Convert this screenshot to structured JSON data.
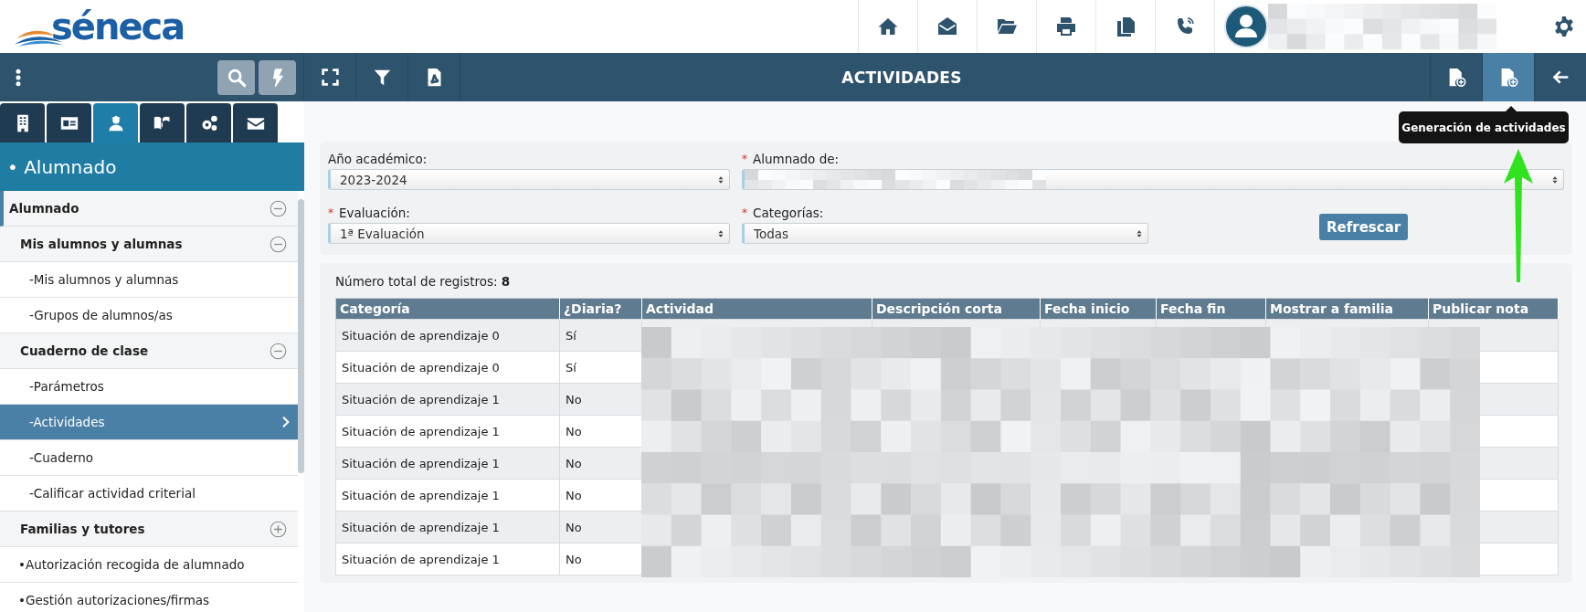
{
  "logo": {
    "text": "séneca"
  },
  "title": "ACTIVIDADES",
  "toolbar_right": [
    {
      "selected": false
    },
    {
      "selected": true
    },
    {
      "selected": false
    }
  ],
  "tooltip": "Generación de actividades",
  "sidebar": {
    "tabs": [
      {
        "selected": false
      },
      {
        "selected": false
      },
      {
        "selected": true
      },
      {
        "selected": false
      },
      {
        "selected": false
      },
      {
        "selected": false
      }
    ],
    "heading": "• Alumnado",
    "items": [
      {
        "label": "Alumnado",
        "kind": "section",
        "expanded": true,
        "children": [
          {
            "label": "Mis alumnos y alumnas",
            "kind": "group",
            "expanded": true,
            "children": [
              {
                "label": "-Mis alumnos y alumnas",
                "kind": "leaf",
                "selected": false
              },
              {
                "label": "-Grupos de alumnos/as",
                "kind": "leaf",
                "selected": false
              }
            ]
          },
          {
            "label": "Cuaderno de clase",
            "kind": "group",
            "expanded": true,
            "children": [
              {
                "label": "-Parámetros",
                "kind": "leaf",
                "selected": false
              },
              {
                "label": "-Actividades",
                "kind": "leaf",
                "selected": true
              },
              {
                "label": "-Cuaderno",
                "kind": "leaf",
                "selected": false
              },
              {
                "label": "-Calificar actividad criterial",
                "kind": "leaf",
                "selected": false
              }
            ]
          },
          {
            "label": "Familias y tutores",
            "kind": "group",
            "expanded": false
          },
          {
            "label": "•Autorización recogida de alumnado",
            "kind": "link",
            "selected": false
          },
          {
            "label": "•Gestión autorizaciones/firmas",
            "kind": "link",
            "selected": false
          }
        ]
      }
    ]
  },
  "form": {
    "rows": [
      [
        {
          "label": "Año académico:",
          "value": "2023-2024"
        },
        {
          "required_mark": "*",
          "label": "Alumnado de:"
        }
      ],
      [
        {
          "required_mark": "*",
          "label": "Evaluación:",
          "value": "1ª Evaluación"
        },
        {
          "required_mark": "*",
          "label": "Categorías:",
          "value": "Todas"
        }
      ]
    ],
    "button": "Refrescar"
  },
  "results": {
    "total": "Número total de registros: **8**",
    "table": {
      "columns": [
        "Categoría",
        "¿Diaria?",
        "Actividad",
        "Descripción corta",
        "Fecha inicio",
        "Fecha fin",
        "Mostrar a familia",
        "Publicar nota"
      ],
      "rows": [
        [
          "Situación de aprendizaje 0",
          "Sí"
        ],
        [
          "Situación de aprendizaje 0",
          "Sí"
        ],
        [
          "Situación de aprendizaje 1",
          "No"
        ],
        [
          "Situación de aprendizaje 1",
          "No"
        ],
        [
          "Situación de aprendizaje 1",
          "No"
        ],
        [
          "Situación de aprendizaje 1",
          "No"
        ],
        [
          "Situación de aprendizaje 1",
          "No"
        ],
        [
          "Situación de aprendizaje 1",
          "No"
        ]
      ]
    }
  }
}
